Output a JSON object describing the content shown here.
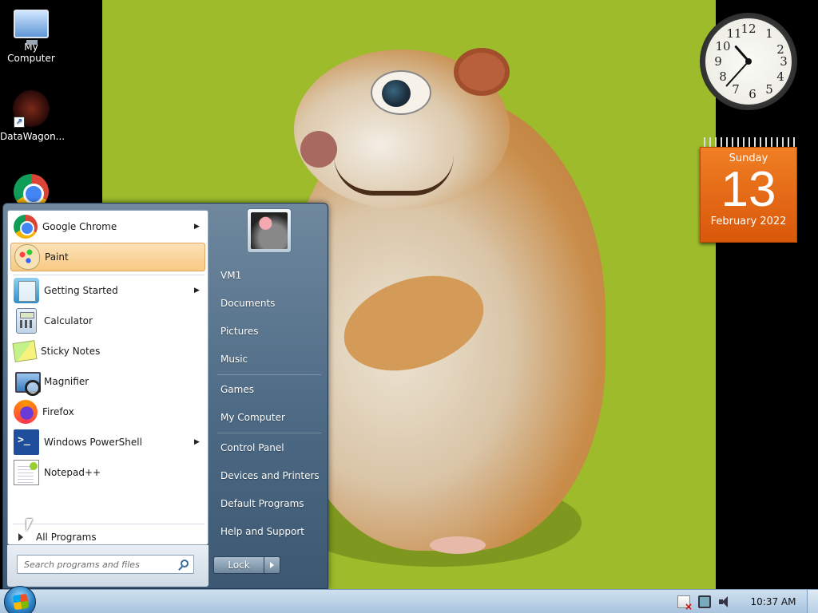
{
  "desktop": {
    "icons": [
      {
        "label": "My Computer",
        "icon": "computer-icon"
      },
      {
        "label": "DataWagon...",
        "icon": "datawagon-icon"
      },
      {
        "label": "",
        "icon": "chrome-icon"
      }
    ]
  },
  "gadgets": {
    "clock": {
      "hour": 10,
      "minute": 37
    },
    "calendar": {
      "day_name": "Sunday",
      "date": "13",
      "month_year": "February 2022"
    }
  },
  "start_menu": {
    "programs": [
      {
        "label": "Google Chrome",
        "icon": "chrome-icon",
        "has_submenu": true
      },
      {
        "label": "Paint",
        "icon": "paint-icon",
        "has_submenu": false,
        "highlighted": true
      },
      {
        "label": "Getting Started",
        "icon": "getting-started-icon",
        "has_submenu": true
      },
      {
        "label": "Calculator",
        "icon": "calculator-icon",
        "has_submenu": false
      },
      {
        "label": "Sticky Notes",
        "icon": "sticky-notes-icon",
        "has_submenu": false
      },
      {
        "label": "Magnifier",
        "icon": "magnifier-icon",
        "has_submenu": false
      },
      {
        "label": "Firefox",
        "icon": "firefox-icon",
        "has_submenu": false
      },
      {
        "label": "Windows PowerShell",
        "icon": "powershell-icon",
        "has_submenu": true
      },
      {
        "label": "Notepad++",
        "icon": "notepadpp-icon",
        "has_submenu": false
      }
    ],
    "all_programs": "All Programs",
    "search_placeholder": "Search programs and files",
    "places": [
      {
        "label": "VM1"
      },
      {
        "label": "Documents"
      },
      {
        "label": "Pictures"
      },
      {
        "label": "Music"
      },
      {
        "label": "Games"
      },
      {
        "label": "My Computer"
      },
      {
        "label": "Control Panel"
      },
      {
        "label": "Devices and Printers"
      },
      {
        "label": "Default Programs"
      },
      {
        "label": "Help and Support"
      }
    ],
    "lock_label": "Lock"
  },
  "taskbar": {
    "time": "10:37 AM",
    "tray_icons": [
      "action-center-flag-icon",
      "network-icon",
      "volume-icon"
    ]
  },
  "colors": {
    "wallpaper": "#9dbb2b",
    "highlight": "#f8c983",
    "calendar": "#e8671a"
  }
}
